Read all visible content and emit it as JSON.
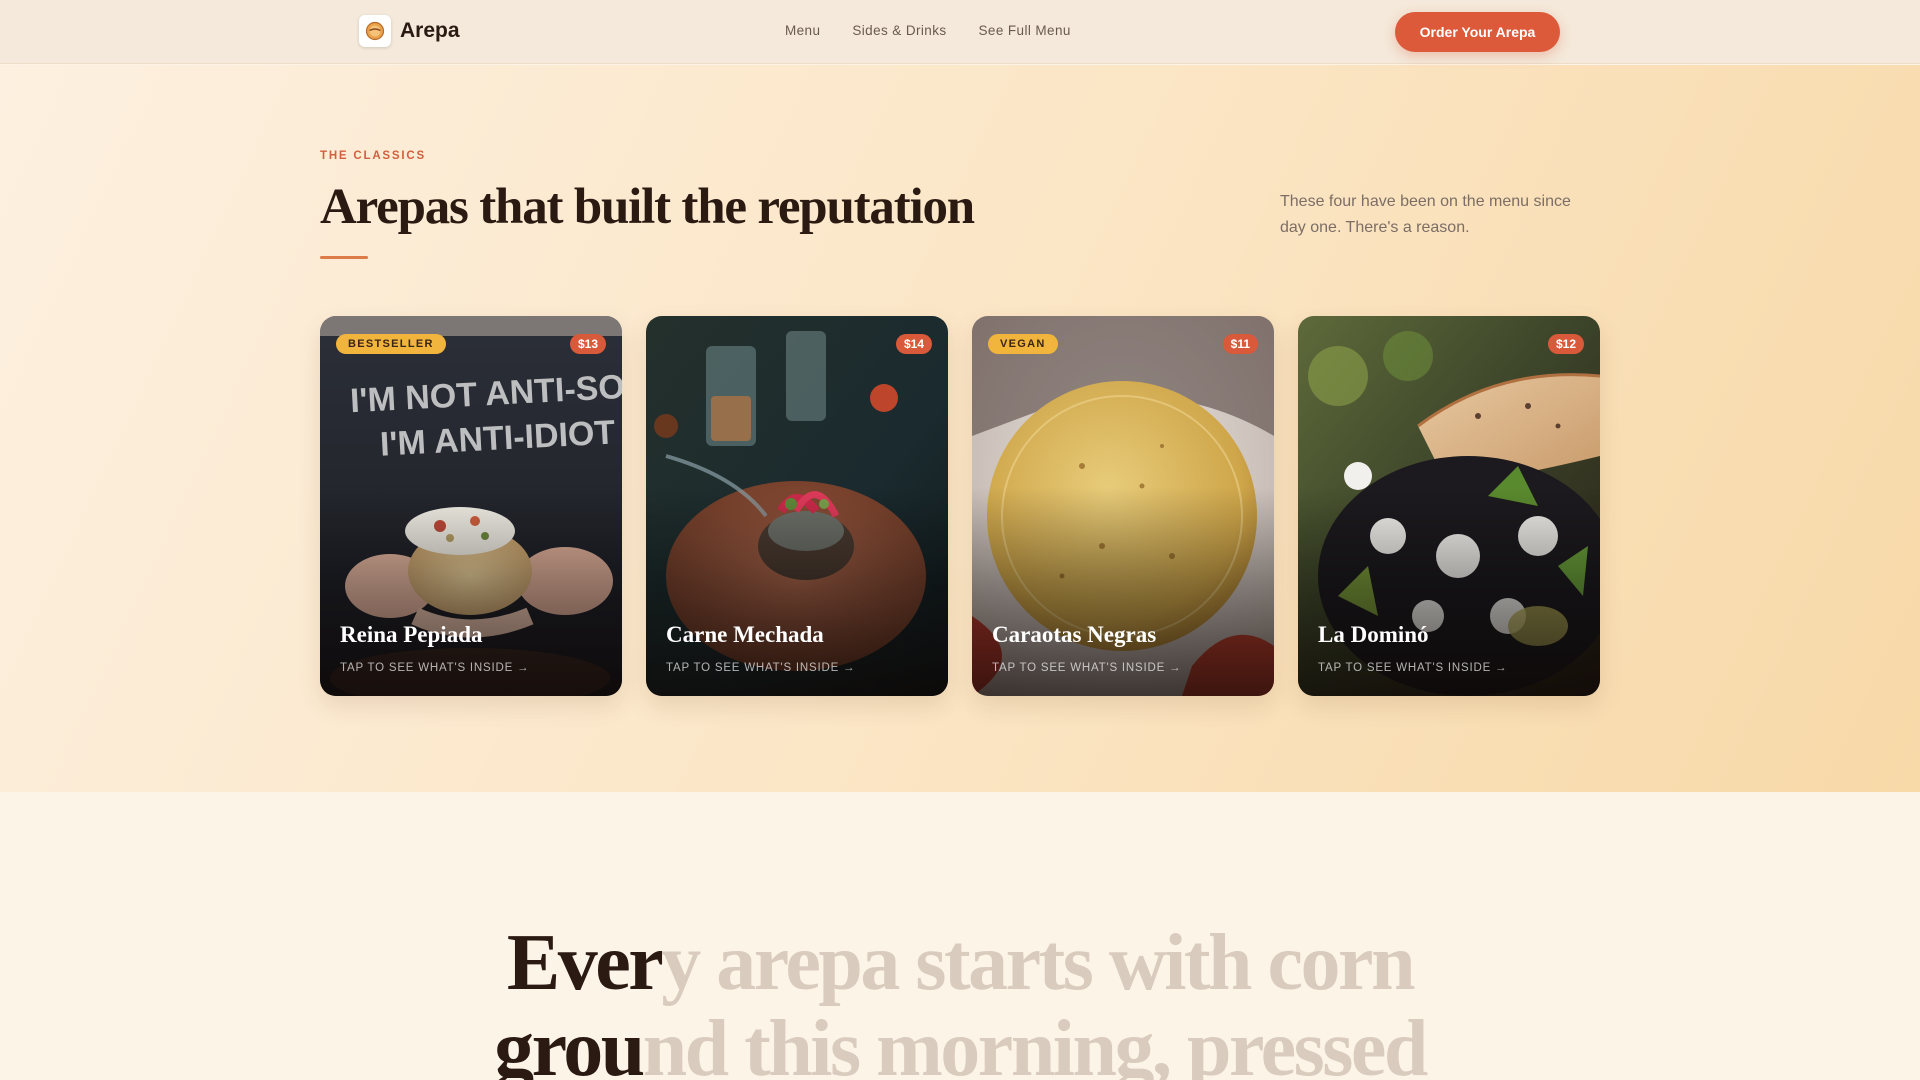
{
  "nav": {
    "brand": "Arepa",
    "links": [
      "Menu",
      "Sides & Drinks",
      "See Full Menu"
    ],
    "cta": "Order Your Arepa"
  },
  "hero": {
    "eyebrow": "THE CLASSICS",
    "heading": "Arepas that built the reputation",
    "lede": "These four have been on the menu since day one. There's a reason."
  },
  "cards": [
    {
      "name": "Reina Pepiada",
      "price": "$13",
      "badge": "BESTSELLER",
      "cta": "TAP TO SEE WHAT'S INSIDE →",
      "shirt_text": "I'M NOT ANTI-SOCIAL I'M ANTI-IDIOT"
    },
    {
      "name": "Carne Mechada",
      "price": "$14",
      "badge": "",
      "cta": "TAP TO SEE WHAT'S INSIDE →"
    },
    {
      "name": "Caraotas Negras",
      "price": "$11",
      "badge": "VEGAN",
      "cta": "TAP TO SEE WHAT'S INSIDE →"
    },
    {
      "name": "La Dominó",
      "price": "$12",
      "badge": "",
      "cta": "TAP TO SEE WHAT'S INSIDE →"
    }
  ],
  "story": {
    "line1_on": "Ever",
    "line1_off": "y arepa starts with corn",
    "line2_on": "grou",
    "line2_off": "nd this morning, pressed"
  },
  "colors": {
    "accent": "#dc5a3a",
    "badge": "#f1b53e",
    "heading": "#2a1a12",
    "eyebrow": "#d2603e"
  },
  "icons": {
    "logo": "arepa-logo-icon"
  }
}
